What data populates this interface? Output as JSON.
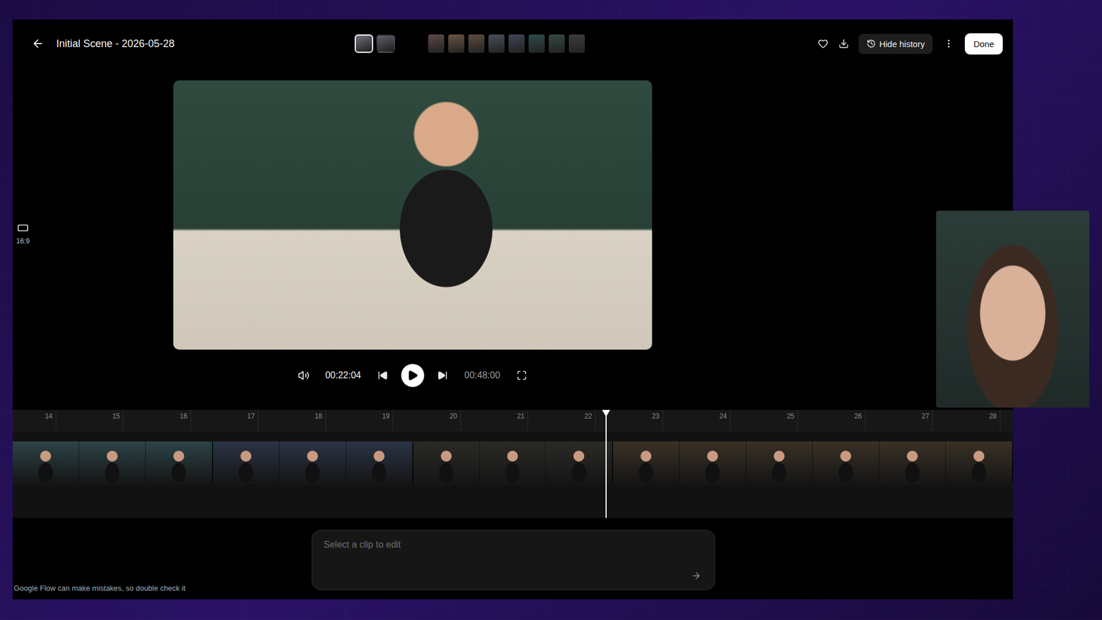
{
  "window": {
    "title": "Initial Scene - 2026-05-28"
  },
  "scene_thumbnails": [
    {
      "selected": true,
      "color": "#6e727a"
    },
    {
      "selected": false,
      "color": "#5c6068"
    }
  ],
  "clip_thumbnails": [
    {
      "color": "#5a4a44"
    },
    {
      "color": "#6a5646"
    },
    {
      "color": "#5e4c40"
    },
    {
      "color": "#4a4e5a"
    },
    {
      "color": "#3e4656"
    },
    {
      "color": "#2f4a4c"
    },
    {
      "color": "#344a46"
    },
    {
      "color": "#3a3e42"
    }
  ],
  "toolbar": {
    "favorite": false,
    "history_button": "Hide history",
    "done_button": "Done"
  },
  "aspect_ratio": "16:9",
  "player": {
    "current_time": "00:22:04",
    "duration": "00:48:00",
    "playing": false
  },
  "timeline": {
    "ticks": [
      "14",
      "15",
      "16",
      "17",
      "18",
      "19",
      "20",
      "21",
      "22",
      "23",
      "24",
      "25",
      "26",
      "27",
      "28"
    ],
    "playhead": 0.593,
    "clips": [
      {
        "frames": 3,
        "color": "#2c4347"
      },
      {
        "frames": 3,
        "color": "#2a3446"
      },
      {
        "frames": 3,
        "color": "#2a2a26"
      },
      {
        "frames": 6,
        "color": "#3a3126"
      }
    ]
  },
  "prompt": {
    "placeholder": "Select a clip to edit"
  },
  "disclaimer": "Google Flow can make mistakes, so double check it"
}
